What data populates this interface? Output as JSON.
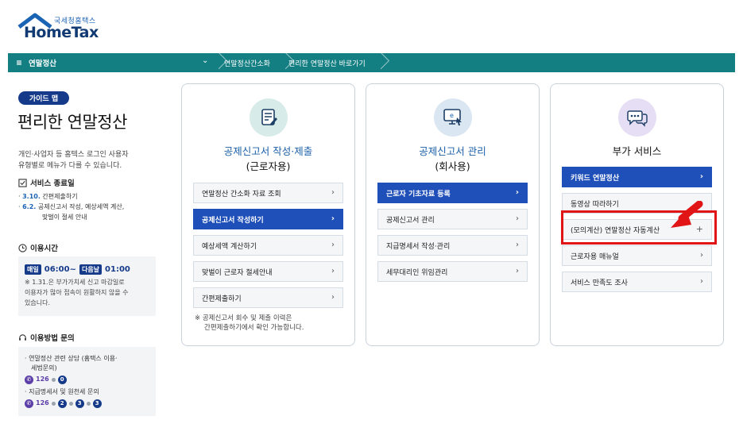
{
  "header": {
    "logo_small": "국세청홈택스",
    "logo_big": "HomeTax"
  },
  "navbar": {
    "menu_label": "연말정산",
    "crumb1": "연말정산간소화",
    "crumb2": "편리한 연말정산 바로가기"
  },
  "sidebar": {
    "guide_badge": "가이드 맵",
    "title": "편리한 연말정산",
    "intro_line1": "개인·사업자 등 홈텍스 로그인 사용자",
    "intro_line2": "유형별로 메뉴가 다를 수 있습니다.",
    "service_end_head": "서비스 종료일",
    "svc1_date": "3.10.",
    "svc1_text": " 간편제출하기",
    "svc2_date": "6.2.",
    "svc2_text": " 공제신고서 작성, 예상세액 계산,",
    "svc2_text2": "맞벌이 절세 안내",
    "hours_head": "이용시간",
    "hours_pill1": "매일",
    "hours_start": "06:00~",
    "hours_pill2": "다음날",
    "hours_end": "01:00",
    "hours_note1": "※ 1.31.은 부가가치세 신고 마감일로",
    "hours_note2": "이용자가 많아 접속이 원활하지 않을 수",
    "hours_note3": "있습니다.",
    "inquiry_head": "이용방법 문의",
    "inq1_line1": "· 연말정산 관련 상담 (홈택스 이용·",
    "inq1_line2": "세법문의)",
    "inq_phone": "126",
    "inq1_num": "0",
    "inq2_line1": "· 지급명세서 및 원천세 문의",
    "inq2_num1": "2",
    "inq2_num2": "3",
    "inq2_num3": "3"
  },
  "cards": {
    "c1": {
      "title": "공제신고서 작성·제출",
      "sub": "(근로자용)",
      "items": [
        "연말정산 간소화 자료 조회",
        "공제신고서 작성하기",
        "예상세액 계산하기",
        "맞벌이 근로자 절세안내",
        "간편제출하기"
      ],
      "note1": "※ 공제신고서 회수 및 제출 이력은",
      "note2": "간편제출하기에서 확인 가능합니다."
    },
    "c2": {
      "title": "공제신고서 관리",
      "sub": "(회사용)",
      "items": [
        "근로자 기초자료 등록",
        "공제신고서 관리",
        "지급명세서 작성·관리",
        "세무대리인 위임관리"
      ]
    },
    "c3": {
      "title": "부가 서비스",
      "items": [
        "키워드 연말정산",
        "동영상 따라하기",
        "(모의계산) 연말정산 자동계산",
        "근로자용 매뉴얼",
        "서비스 만족도 조사"
      ]
    }
  },
  "colors": {
    "nav_teal": "#137f83",
    "primary_blue": "#1f4fb8",
    "highlight_red": "#e11515"
  }
}
